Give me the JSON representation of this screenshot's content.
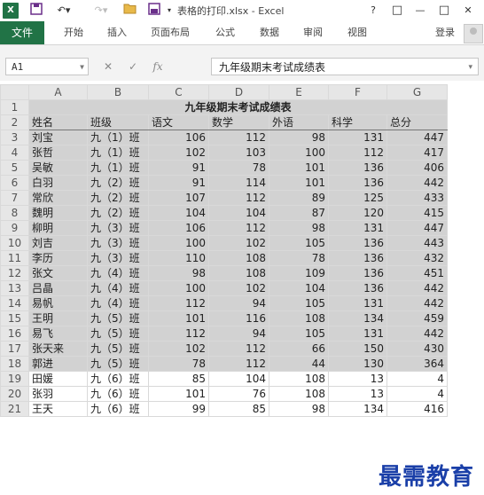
{
  "window": {
    "title": "表格的打印.xlsx - Excel",
    "app_icon_label": "X"
  },
  "quick_access": [
    "save-icon",
    "undo-icon",
    "redo-icon",
    "open-icon",
    "print-preview-icon",
    "customize-icon"
  ],
  "window_controls": {
    "help": "?",
    "restore": "□",
    "minimize": "—",
    "maximize": "□",
    "close": "✕"
  },
  "ribbon": {
    "file_tab": "文件",
    "tabs": [
      "开始",
      "插入",
      "页面布局",
      "公式",
      "数据",
      "审阅",
      "视图"
    ],
    "login": "登录"
  },
  "formula_bar": {
    "name_box": "A1",
    "cancel_icon": "✕",
    "enter_icon": "✓",
    "fx_label": "fx",
    "content": "九年级期末考试成绩表"
  },
  "sheet": {
    "columns": [
      "A",
      "B",
      "C",
      "D",
      "E",
      "F",
      "G"
    ],
    "title": "九年级期末考试成绩表",
    "headers": [
      "姓名",
      "班级",
      "语文",
      "数学",
      "外语",
      "科学",
      "总分"
    ],
    "rows": [
      [
        "刘宝",
        "九（1）班",
        "106",
        "112",
        "98",
        "131",
        "447"
      ],
      [
        "张哲",
        "九（1）班",
        "102",
        "103",
        "100",
        "112",
        "417"
      ],
      [
        "吴敏",
        "九（1）班",
        "91",
        "78",
        "101",
        "136",
        "406"
      ],
      [
        "白羽",
        "九（2）班",
        "91",
        "114",
        "101",
        "136",
        "442"
      ],
      [
        "常欣",
        "九（2）班",
        "107",
        "112",
        "89",
        "125",
        "433"
      ],
      [
        "魏明",
        "九（2）班",
        "104",
        "104",
        "87",
        "120",
        "415"
      ],
      [
        "柳明",
        "九（3）班",
        "106",
        "112",
        "98",
        "131",
        "447"
      ],
      [
        "刘吉",
        "九（3）班",
        "100",
        "102",
        "105",
        "136",
        "443"
      ],
      [
        "李历",
        "九（3）班",
        "110",
        "108",
        "78",
        "136",
        "432"
      ],
      [
        "张文",
        "九（4）班",
        "98",
        "108",
        "109",
        "136",
        "451"
      ],
      [
        "吕晶",
        "九（4）班",
        "100",
        "102",
        "104",
        "136",
        "442"
      ],
      [
        "易帆",
        "九（4）班",
        "112",
        "94",
        "105",
        "131",
        "442"
      ],
      [
        "王明",
        "九（5）班",
        "101",
        "116",
        "108",
        "134",
        "459"
      ],
      [
        "易飞",
        "九（5）班",
        "112",
        "94",
        "105",
        "131",
        "442"
      ],
      [
        "张天来",
        "九（5）班",
        "102",
        "112",
        "66",
        "150",
        "430"
      ],
      [
        "郭进",
        "九（5）班",
        "78",
        "112",
        "44",
        "130",
        "364"
      ],
      [
        "田媛",
        "九（6）班",
        "85",
        "104",
        "108",
        "13",
        "4"
      ],
      [
        "张羽",
        "九（6）班",
        "101",
        "76",
        "108",
        "13",
        "4"
      ],
      [
        "王天",
        "九（6）班",
        "99",
        "85",
        "98",
        "134",
        "416"
      ]
    ],
    "row_numbers": [
      "1",
      "2",
      "3",
      "4",
      "5",
      "6",
      "7",
      "8",
      "9",
      "10",
      "11",
      "12",
      "13",
      "14",
      "15",
      "16",
      "17",
      "18",
      "19",
      "20",
      "21"
    ]
  },
  "watermark": "最需教育",
  "colors": {
    "excel_green": "#217346",
    "selection_gray": "#d2d2d2",
    "watermark_blue": "#1a3fa8"
  }
}
